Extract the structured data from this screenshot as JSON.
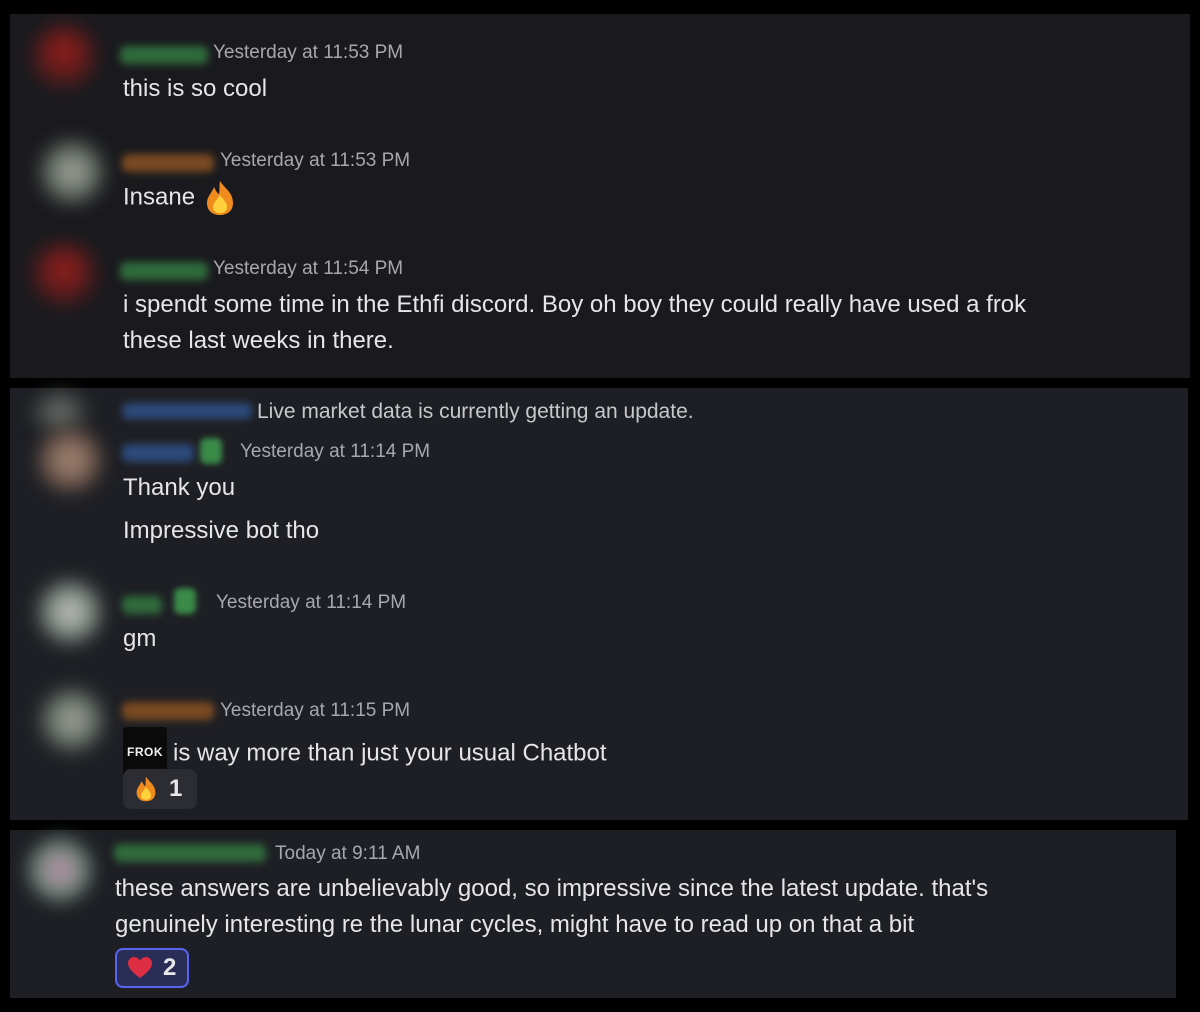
{
  "panels": [
    {
      "messages": [
        {
          "timestamp": "Yesterday at 11:53 PM",
          "lines": [
            "this is so cool"
          ]
        },
        {
          "timestamp": "Yesterday at 11:53 PM",
          "lines": [
            "Insane"
          ],
          "emoji": "fire-icon"
        },
        {
          "timestamp": "Yesterday at 11:54 PM",
          "lines": [
            "i spendt some time in the Ethfi discord. Boy oh boy they could really have used a frok",
            "these last weeks in there."
          ]
        }
      ]
    },
    {
      "system_line": "Live market data is currently getting an update.",
      "messages": [
        {
          "timestamp": "Yesterday at 11:14 PM",
          "lines": [
            "Thank you",
            "Impressive bot tho"
          ]
        },
        {
          "timestamp": "Yesterday at 11:14 PM",
          "lines": [
            "gm"
          ]
        },
        {
          "timestamp": "Yesterday at 11:15 PM",
          "lines": [
            "is way more than just your usual Chatbot"
          ],
          "inline_badge": "FROK",
          "reaction": {
            "icon": "fire-icon",
            "count": "1"
          }
        }
      ]
    },
    {
      "messages": [
        {
          "timestamp": "Today at 9:11 AM",
          "lines": [
            "these answers are unbelievably good, so impressive since the latest update.  that's",
            "genuinely interesting re the lunar cycles, might have to read up on that a bit"
          ],
          "reaction": {
            "icon": "heart-icon",
            "count": "2"
          }
        }
      ]
    }
  ],
  "colors": {
    "background": "#000000",
    "panel": "#1e1f24",
    "text": "#e6e6e8",
    "timestamp": "#a6a8ae",
    "reaction_highlight": "#5865f2"
  }
}
